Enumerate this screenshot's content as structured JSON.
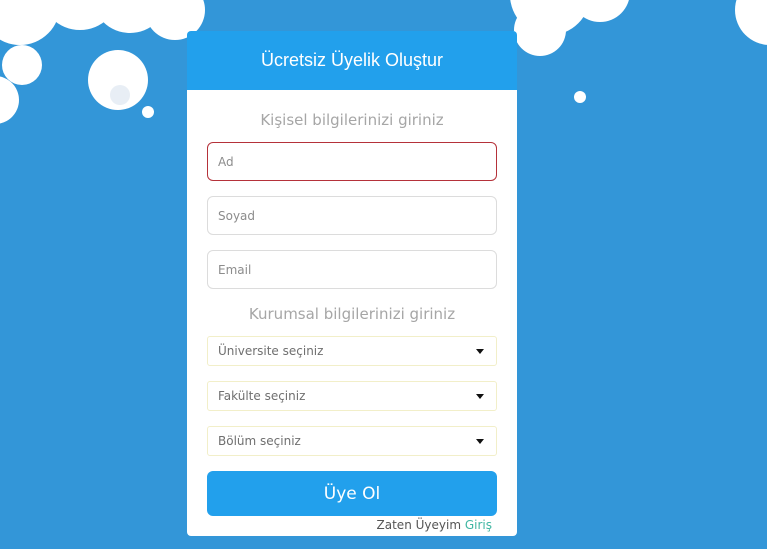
{
  "form": {
    "title": "Ücretsiz Üyelik Oluştur",
    "personal_section_title": "Kişisel bilgilerinizi giriniz",
    "first_name_placeholder": "Ad",
    "last_name_placeholder": "Soyad",
    "email_placeholder": "Email",
    "institution_section_title": "Kurumsal bilgilerinizi giriniz",
    "university_select": "Üniversite seçiniz",
    "faculty_select": "Fakülte seçiniz",
    "department_select": "Bölüm seçiniz",
    "submit_label": "Üye Ol",
    "login_prompt": "Zaten Üyeyim",
    "login_link": "Giriş"
  },
  "colors": {
    "background": "#3396d8",
    "accent": "#22a0ec",
    "invalid_border": "#b5323a",
    "link": "#3fb6a2"
  },
  "icons": {
    "dropdown": "caret-down-icon",
    "background_art": "cloud-decoration"
  }
}
